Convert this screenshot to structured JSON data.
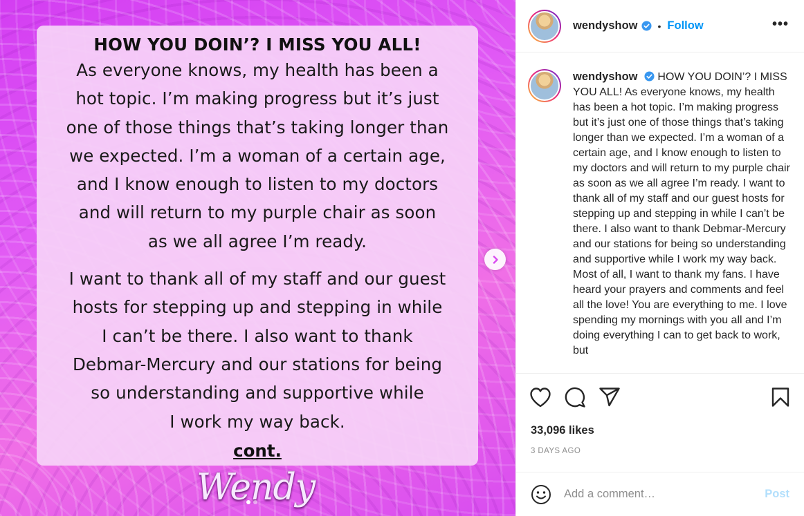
{
  "media": {
    "card": {
      "heading": "HOW YOU DOIN’? I MISS YOU ALL!",
      "paragraph1_lines": [
        "As everyone knows, my health has been a",
        "hot topic. I’m making progress but it’s just",
        "one of those things that’s taking longer than",
        "we expected. I’m a woman of a certain age,",
        "and I know enough to listen to my doctors",
        "and will return to my purple chair as soon",
        "as we all agree I’m ready."
      ],
      "paragraph2_lines": [
        "I want to thank all of my staff and our guest",
        "hosts for stepping up and stepping in while",
        "I can’t be there. I also want to thank",
        "Debmar-Mercury and our stations for being",
        "so understanding and supportive while",
        "I work my way back."
      ],
      "cont": "cont."
    },
    "logo_text": "Wendy",
    "next_icon": "chevron-right-icon",
    "carousel": {
      "count": 2,
      "active_index": 0
    },
    "colors": {
      "background": "#d94cf0",
      "card": "#f6d2f8"
    }
  },
  "header": {
    "username": "wendyshow",
    "verified_icon": "verified-badge-icon",
    "bullet": "•",
    "follow_label": "Follow",
    "more_label": "•••"
  },
  "caption": {
    "username": "wendyshow",
    "text": "HOW YOU DOIN’? I MISS YOU ALL! As everyone knows, my health has been a hot topic. I’m making progress but it’s just one of those things that’s taking longer than we expected. I’m a woman of a certain age, and I know enough to listen to my doctors and will return to my purple chair as soon as we all agree I’m ready. I want to thank all of my staff and our guest hosts for stepping up and stepping in while I can’t be there. I also want to thank Debmar-Mercury and our stations for being so understanding and supportive while I work my way back. Most of all, I want to thank my fans. I have heard your prayers and comments and feel all the love! You are everything to me. I love spending my mornings with you all and I’m doing everything I can to get back to work, but"
  },
  "actions": {
    "like_icon": "heart-icon",
    "comment_icon": "comment-icon",
    "share_icon": "share-icon",
    "save_icon": "bookmark-icon"
  },
  "likes": "33,096 likes",
  "time_ago": "3 DAYS AGO",
  "add_comment": {
    "emoji_icon": "smiley-icon",
    "placeholder": "Add a comment…",
    "post_label": "Post"
  },
  "colors": {
    "link_blue": "#0095f6",
    "post_disabled": "#b2dffc",
    "muted": "#8e8e8e"
  }
}
